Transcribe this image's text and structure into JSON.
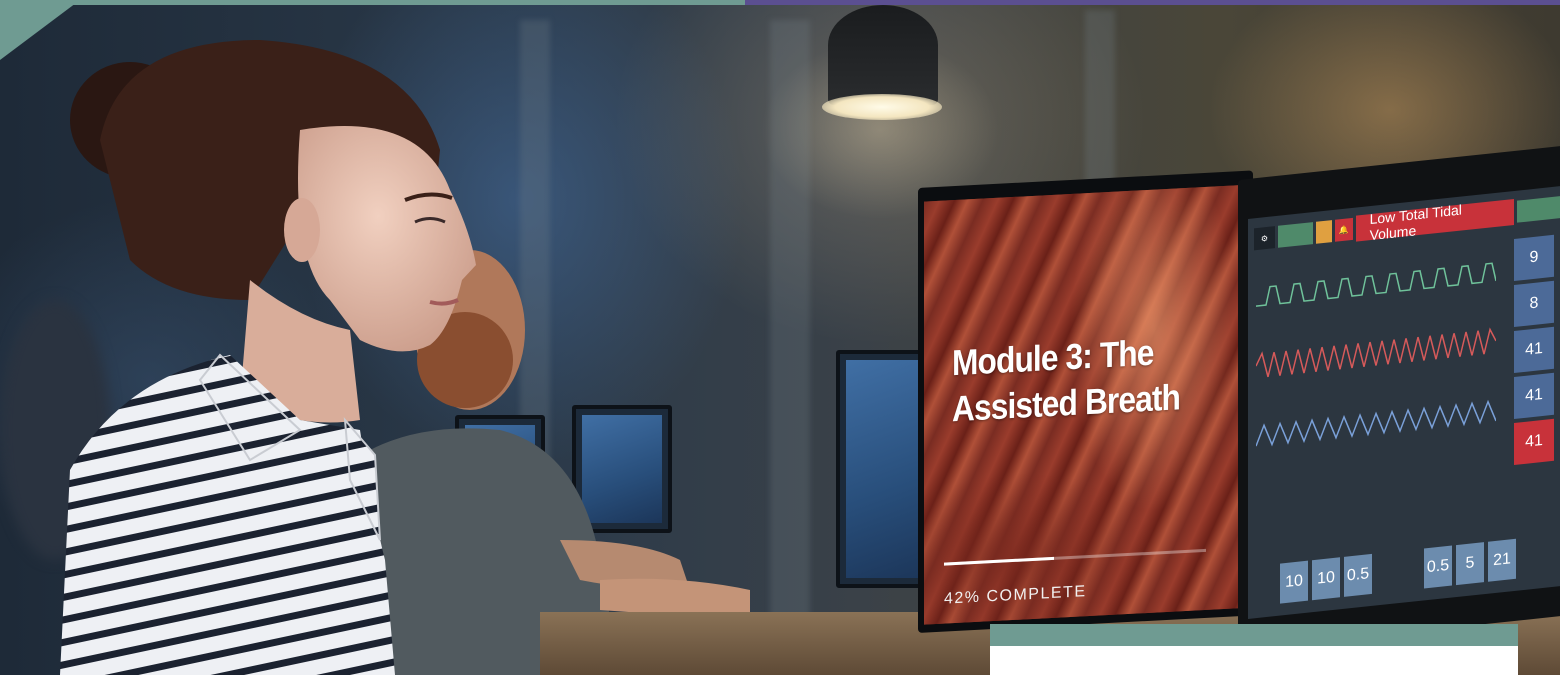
{
  "lesson_screen": {
    "title_line1": "Module 3: The",
    "title_line2": "Assisted Breath",
    "progress_label": "42% COMPLETE",
    "progress_percent": 42
  },
  "ventilator_screen": {
    "alarm_banner": "Low Total Tidal Volume",
    "side_values": [
      "9",
      "8",
      "41",
      "41",
      "41"
    ],
    "bottom_values": [
      "10",
      "10",
      "0.5",
      "0.5",
      "5",
      "21"
    ]
  },
  "colors": {
    "accent_teal": "#6f9b92",
    "accent_purple": "#5b4f91",
    "alarm_red": "#c8323a",
    "tile_blue": "#4c6a98"
  }
}
